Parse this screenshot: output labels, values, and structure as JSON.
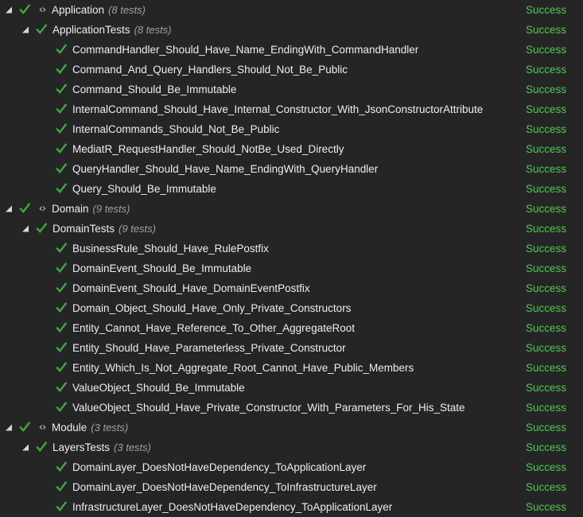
{
  "panel": {
    "name": "test-explorer-tree",
    "background_color": "#252526",
    "outcome_color": "#4ec94e",
    "label_color": "#eeeeee",
    "count_color": "#a0a0a0"
  },
  "icons": {
    "expanded_triangle": "triangle-expanded-icon",
    "passed": "check-passed-icon",
    "namespace": "code-brackets-icon",
    "namespace_glyph": "‹›"
  },
  "rows": [
    {
      "level": 0,
      "expander": true,
      "code_icon": true,
      "label": "Application",
      "count": "(8 tests)",
      "outcome": "Success"
    },
    {
      "level": 1,
      "expander": true,
      "code_icon": false,
      "label": "ApplicationTests",
      "count": "(8 tests)",
      "outcome": "Success"
    },
    {
      "level": 2,
      "expander": false,
      "code_icon": false,
      "label": "CommandHandler_Should_Have_Name_EndingWith_CommandHandler",
      "count": "",
      "outcome": "Success"
    },
    {
      "level": 2,
      "expander": false,
      "code_icon": false,
      "label": "Command_And_Query_Handlers_Should_Not_Be_Public",
      "count": "",
      "outcome": "Success"
    },
    {
      "level": 2,
      "expander": false,
      "code_icon": false,
      "label": "Command_Should_Be_Immutable",
      "count": "",
      "outcome": "Success"
    },
    {
      "level": 2,
      "expander": false,
      "code_icon": false,
      "label": "InternalCommand_Should_Have_Internal_Constructor_With_JsonConstructorAttribute",
      "count": "",
      "outcome": "Success"
    },
    {
      "level": 2,
      "expander": false,
      "code_icon": false,
      "label": "InternalCommands_Should_Not_Be_Public",
      "count": "",
      "outcome": "Success"
    },
    {
      "level": 2,
      "expander": false,
      "code_icon": false,
      "label": "MediatR_RequestHandler_Should_NotBe_Used_Directly",
      "count": "",
      "outcome": "Success"
    },
    {
      "level": 2,
      "expander": false,
      "code_icon": false,
      "label": "QueryHandler_Should_Have_Name_EndingWith_QueryHandler",
      "count": "",
      "outcome": "Success"
    },
    {
      "level": 2,
      "expander": false,
      "code_icon": false,
      "label": "Query_Should_Be_Immutable",
      "count": "",
      "outcome": "Success"
    },
    {
      "level": 0,
      "expander": true,
      "code_icon": true,
      "label": "Domain",
      "count": "(9 tests)",
      "outcome": "Success"
    },
    {
      "level": 1,
      "expander": true,
      "code_icon": false,
      "label": "DomainTests",
      "count": "(9 tests)",
      "outcome": "Success"
    },
    {
      "level": 2,
      "expander": false,
      "code_icon": false,
      "label": "BusinessRule_Should_Have_RulePostfix",
      "count": "",
      "outcome": "Success"
    },
    {
      "level": 2,
      "expander": false,
      "code_icon": false,
      "label": "DomainEvent_Should_Be_Immutable",
      "count": "",
      "outcome": "Success"
    },
    {
      "level": 2,
      "expander": false,
      "code_icon": false,
      "label": "DomainEvent_Should_Have_DomainEventPostfix",
      "count": "",
      "outcome": "Success"
    },
    {
      "level": 2,
      "expander": false,
      "code_icon": false,
      "label": "Domain_Object_Should_Have_Only_Private_Constructors",
      "count": "",
      "outcome": "Success"
    },
    {
      "level": 2,
      "expander": false,
      "code_icon": false,
      "label": "Entity_Cannot_Have_Reference_To_Other_AggregateRoot",
      "count": "",
      "outcome": "Success"
    },
    {
      "level": 2,
      "expander": false,
      "code_icon": false,
      "label": "Entity_Should_Have_Parameterless_Private_Constructor",
      "count": "",
      "outcome": "Success"
    },
    {
      "level": 2,
      "expander": false,
      "code_icon": false,
      "label": "Entity_Which_Is_Not_Aggregate_Root_Cannot_Have_Public_Members",
      "count": "",
      "outcome": "Success"
    },
    {
      "level": 2,
      "expander": false,
      "code_icon": false,
      "label": "ValueObject_Should_Be_Immutable",
      "count": "",
      "outcome": "Success"
    },
    {
      "level": 2,
      "expander": false,
      "code_icon": false,
      "label": "ValueObject_Should_Have_Private_Constructor_With_Parameters_For_His_State",
      "count": "",
      "outcome": "Success"
    },
    {
      "level": 0,
      "expander": true,
      "code_icon": true,
      "label": "Module",
      "count": "(3 tests)",
      "outcome": "Success"
    },
    {
      "level": 1,
      "expander": true,
      "code_icon": false,
      "label": "LayersTests",
      "count": "(3 tests)",
      "outcome": "Success"
    },
    {
      "level": 2,
      "expander": false,
      "code_icon": false,
      "label": "DomainLayer_DoesNotHaveDependency_ToApplicationLayer",
      "count": "",
      "outcome": "Success"
    },
    {
      "level": 2,
      "expander": false,
      "code_icon": false,
      "label": "DomainLayer_DoesNotHaveDependency_ToInfrastructureLayer",
      "count": "",
      "outcome": "Success"
    },
    {
      "level": 2,
      "expander": false,
      "code_icon": false,
      "label": "InfrastructureLayer_DoesNotHaveDependency_ToApplicationLayer",
      "count": "",
      "outcome": "Success"
    }
  ]
}
